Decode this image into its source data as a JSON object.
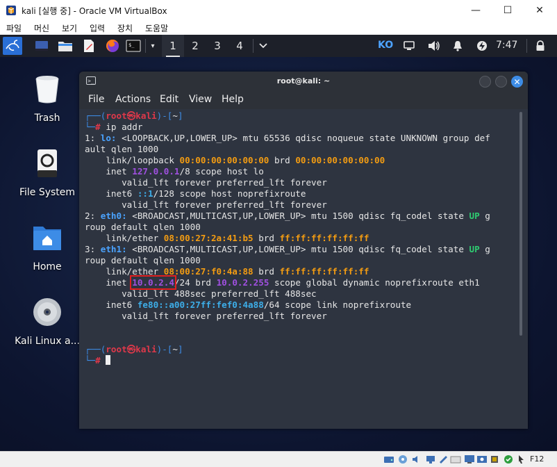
{
  "window": {
    "title": "kali [실행 중] - Oracle VM VirtualBox",
    "minimize": "—",
    "maximize": "☐",
    "close": "✕"
  },
  "menubar": [
    "파일",
    "머신",
    "보기",
    "입력",
    "장치",
    "도움말"
  ],
  "panel": {
    "workspaces": [
      "1",
      "2",
      "3",
      "4"
    ],
    "active_workspace": "1",
    "keyboard_layout": "KO",
    "clock": "7:47"
  },
  "desktop_icons": [
    {
      "label": "Trash",
      "icon": "trash-icon"
    },
    {
      "label": "File System",
      "icon": "drive-icon"
    },
    {
      "label": "Home",
      "icon": "home-folder-icon"
    },
    {
      "label": "Kali Linux a...",
      "icon": "disc-icon"
    }
  ],
  "terminal": {
    "title": "root@kali: ~",
    "menu": [
      "File",
      "Actions",
      "Edit",
      "View",
      "Help"
    ],
    "prompt_user": "root",
    "prompt_host": "kali",
    "prompt_dir": "~",
    "command": "ip addr",
    "highlight": "10.0.2.4",
    "lines": [
      {
        "t": "prompt1"
      },
      {
        "t": "cmd",
        "text": "ip addr"
      },
      {
        "t": "seg",
        "parts": [
          [
            "1: ",
            ""
          ],
          [
            "lo:",
            "c-lblue"
          ],
          [
            " <LOOPBACK,UP,LOWER_UP> mtu 65536 qdisc noqueue state UNKNOWN group def",
            ""
          ]
        ]
      },
      {
        "t": "seg",
        "parts": [
          [
            "ault qlen 1000",
            ""
          ]
        ]
      },
      {
        "t": "seg",
        "parts": [
          [
            "    link/loopback ",
            ""
          ],
          [
            "00:00:00:00:00:00",
            "c-orange"
          ],
          [
            " brd ",
            ""
          ],
          [
            "00:00:00:00:00:00",
            "c-orange"
          ]
        ]
      },
      {
        "t": "seg",
        "parts": [
          [
            "    inet ",
            ""
          ],
          [
            "127.0.0.1",
            "c-purple"
          ],
          [
            "/8 scope host lo",
            ""
          ]
        ]
      },
      {
        "t": "seg",
        "parts": [
          [
            "       valid_lft forever preferred_lft forever",
            ""
          ]
        ]
      },
      {
        "t": "seg",
        "parts": [
          [
            "    inet6 ",
            ""
          ],
          [
            "::1",
            "c-cyan"
          ],
          [
            "/128 scope host noprefixroute",
            ""
          ]
        ]
      },
      {
        "t": "seg",
        "parts": [
          [
            "       valid_lft forever preferred_lft forever",
            ""
          ]
        ]
      },
      {
        "t": "seg",
        "parts": [
          [
            "2: ",
            ""
          ],
          [
            "eth0:",
            "c-lblue"
          ],
          [
            " <BROADCAST,MULTICAST,UP,LOWER_UP> mtu 1500 qdisc fq_codel state ",
            ""
          ],
          [
            "UP",
            "c-green"
          ],
          [
            " g",
            ""
          ]
        ]
      },
      {
        "t": "seg",
        "parts": [
          [
            "roup default qlen 1000",
            ""
          ]
        ]
      },
      {
        "t": "seg",
        "parts": [
          [
            "    link/ether ",
            ""
          ],
          [
            "08:00:27:2a:41:b5",
            "c-orange"
          ],
          [
            " brd ",
            ""
          ],
          [
            "ff:ff:ff:ff:ff:ff",
            "c-orange"
          ]
        ]
      },
      {
        "t": "seg",
        "parts": [
          [
            "3: ",
            ""
          ],
          [
            "eth1:",
            "c-lblue"
          ],
          [
            " <BROADCAST,MULTICAST,UP,LOWER_UP> mtu 1500 qdisc fq_codel state ",
            ""
          ],
          [
            "UP",
            "c-green"
          ],
          [
            " g",
            ""
          ]
        ]
      },
      {
        "t": "seg",
        "parts": [
          [
            "roup default qlen 1000",
            ""
          ]
        ]
      },
      {
        "t": "seg",
        "parts": [
          [
            "    link/ether ",
            ""
          ],
          [
            "08:00:27:f0:4a:88",
            "c-orange"
          ],
          [
            " brd ",
            ""
          ],
          [
            "ff:ff:ff:ff:ff:ff",
            "c-orange"
          ]
        ]
      },
      {
        "t": "seg",
        "parts": [
          [
            "    inet ",
            ""
          ],
          [
            "10.0.2.4",
            "c-purple hl"
          ],
          [
            "/24 brd ",
            ""
          ],
          [
            "10.0.2.255",
            "c-purple"
          ],
          [
            " scope global dynamic noprefixroute eth1",
            ""
          ]
        ]
      },
      {
        "t": "seg",
        "parts": [
          [
            "       valid_lft 488sec preferred_lft 488sec",
            ""
          ]
        ]
      },
      {
        "t": "seg",
        "parts": [
          [
            "    inet6 ",
            ""
          ],
          [
            "fe80::a00:27ff:fef0:4a88",
            "c-cyan"
          ],
          [
            "/64 scope link noprefixroute",
            ""
          ]
        ]
      },
      {
        "t": "seg",
        "parts": [
          [
            "       valid_lft forever preferred_lft forever",
            ""
          ]
        ]
      },
      {
        "t": "blank"
      },
      {
        "t": "blank"
      },
      {
        "t": "prompt1"
      },
      {
        "t": "cursor"
      }
    ]
  },
  "status_bar": {
    "host_key": "F12"
  },
  "colors": {
    "kali_blue": "#3d8ce6",
    "prompt_red": "#e0384a",
    "highlight_box": "#e02020"
  }
}
